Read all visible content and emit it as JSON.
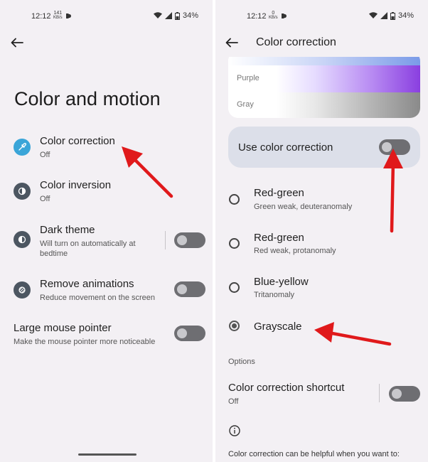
{
  "left": {
    "status": {
      "time": "12:12",
      "net_top": "141",
      "net_bottom": "KB/s",
      "battery": "34%"
    },
    "title": "Color and motion",
    "items": [
      {
        "label": "Color correction",
        "sub": "Off"
      },
      {
        "label": "Color inversion",
        "sub": "Off"
      },
      {
        "label": "Dark theme",
        "sub1": "Will turn on automatically at",
        "sub2": "bedtime",
        "toggle": false
      },
      {
        "label": "Remove animations",
        "sub": "Reduce movement on the screen",
        "toggle": false
      },
      {
        "label": "Large mouse pointer",
        "sub": "Make the mouse pointer more noticeable",
        "toggle": false
      }
    ]
  },
  "right": {
    "status": {
      "time": "12:12",
      "net_top": "0",
      "net_bottom": "KB/s",
      "battery": "34%"
    },
    "title": "Color correction",
    "preview": {
      "purple": "Purple",
      "gray": "Gray"
    },
    "use_label": "Use color correction",
    "use_toggle": false,
    "options": [
      {
        "label": "Red-green",
        "sub": "Green weak, deuteranomaly",
        "selected": false
      },
      {
        "label": "Red-green",
        "sub": "Red weak, protanomaly",
        "selected": false
      },
      {
        "label": "Blue-yellow",
        "sub": "Tritanomaly",
        "selected": false
      },
      {
        "label": "Grayscale",
        "sub": "",
        "selected": true
      }
    ],
    "options_header": "Options",
    "shortcut": {
      "label": "Color correction shortcut",
      "sub": "Off",
      "toggle": false
    },
    "footer": "Color correction can be helpful when you want to:"
  },
  "colors": {
    "panel_bg": "#f3f0f4",
    "annotation_arrow": "#e0191b",
    "accent_icon": "#3aa5d8",
    "icon_dark": "#4c5661",
    "card_bg": "#dcdfe9"
  }
}
